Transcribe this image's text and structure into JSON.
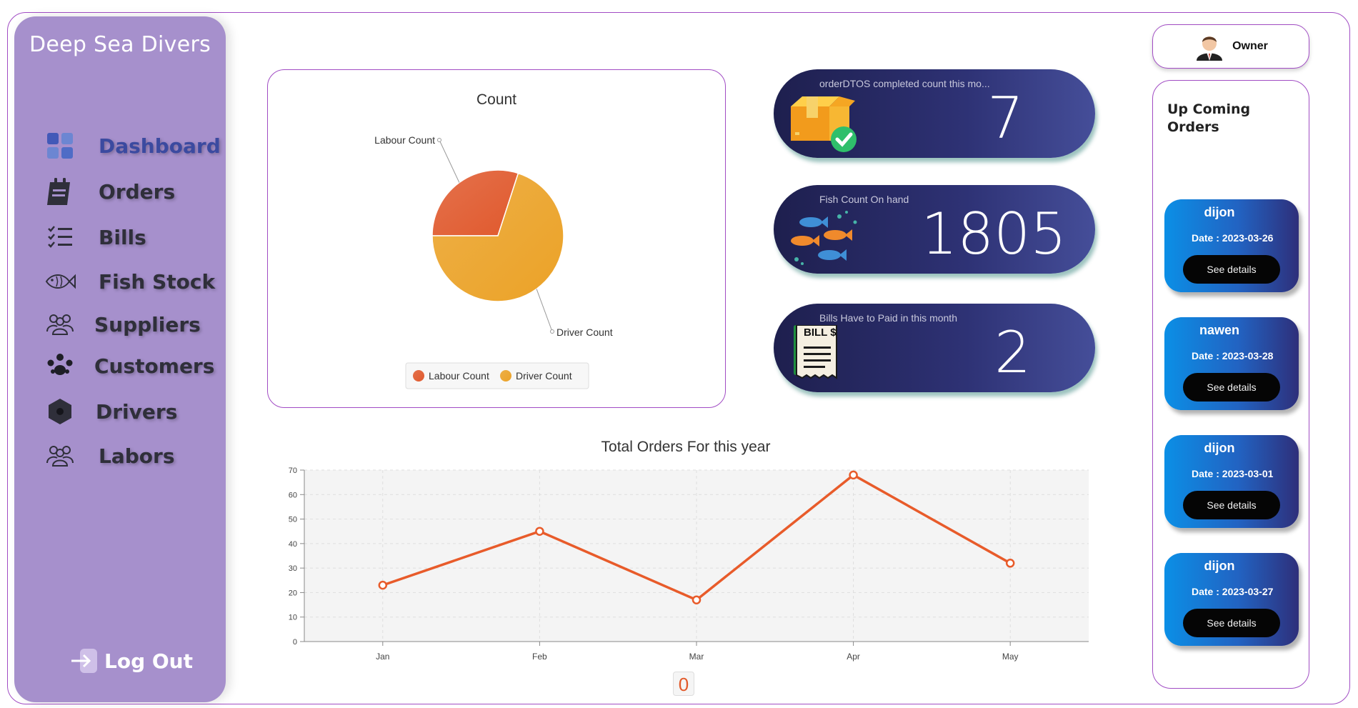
{
  "sidebar": {
    "brand": "Deep Sea Divers",
    "items": [
      {
        "label": "Dashboard",
        "icon": "dashboard-icon"
      },
      {
        "label": "Orders",
        "icon": "orders-icon"
      },
      {
        "label": "Bills",
        "icon": "checklist-icon"
      },
      {
        "label": "Fish Stock",
        "icon": "fish-icon"
      },
      {
        "label": "Suppliers",
        "icon": "people-group-icon"
      },
      {
        "label": "Customers",
        "icon": "customers-icon"
      },
      {
        "label": "Drivers",
        "icon": "hexagon-icon"
      },
      {
        "label": "Labors",
        "icon": "people-group-icon"
      }
    ],
    "logout_label": "Log Out"
  },
  "pie": {
    "title": "Count",
    "slices": [
      {
        "name": "Labour Count",
        "value": 3,
        "color": "#e0592d"
      },
      {
        "name": "Driver Count",
        "value": 7,
        "color": "#eba227"
      }
    ]
  },
  "stats": [
    {
      "label": "orderDTOS completed count this mo...",
      "value": "7",
      "icon": "package-check-icon"
    },
    {
      "label": "Fish Count On hand",
      "value": "1805",
      "icon": "fish-school-icon"
    },
    {
      "label": "Bills Have to Paid in this month",
      "value": "2",
      "icon": "bill-icon",
      "icon_text": "BILL $"
    }
  ],
  "line": {
    "title": "Total Orders For this year"
  },
  "counter": "0",
  "owner": {
    "label": "Owner"
  },
  "upcoming": {
    "title": "Up Coming Orders",
    "orders": [
      {
        "name": "dijon",
        "date": "Date : 2023-03-26",
        "button": "See details"
      },
      {
        "name": "nawen",
        "date": "Date : 2023-03-28",
        "button": "See details"
      },
      {
        "name": "dijon",
        "date": "Date : 2023-03-01",
        "button": "See details"
      },
      {
        "name": "dijon",
        "date": "Date : 2023-03-27",
        "button": "See details"
      }
    ]
  },
  "chart_data": [
    {
      "type": "pie",
      "title": "Count",
      "categories": [
        "Labour Count",
        "Driver Count"
      ],
      "values": [
        3,
        7
      ],
      "legend": "bottom"
    },
    {
      "type": "line",
      "title": "Total Orders For this year",
      "categories": [
        "Jan",
        "Feb",
        "Mar",
        "Apr",
        "May"
      ],
      "values": [
        23,
        45,
        17,
        68,
        32
      ],
      "ylim": [
        0,
        70
      ],
      "yticks": [
        0,
        10,
        20,
        30,
        40,
        50,
        60,
        70
      ],
      "grid": true,
      "color": "#e85b2a"
    }
  ]
}
